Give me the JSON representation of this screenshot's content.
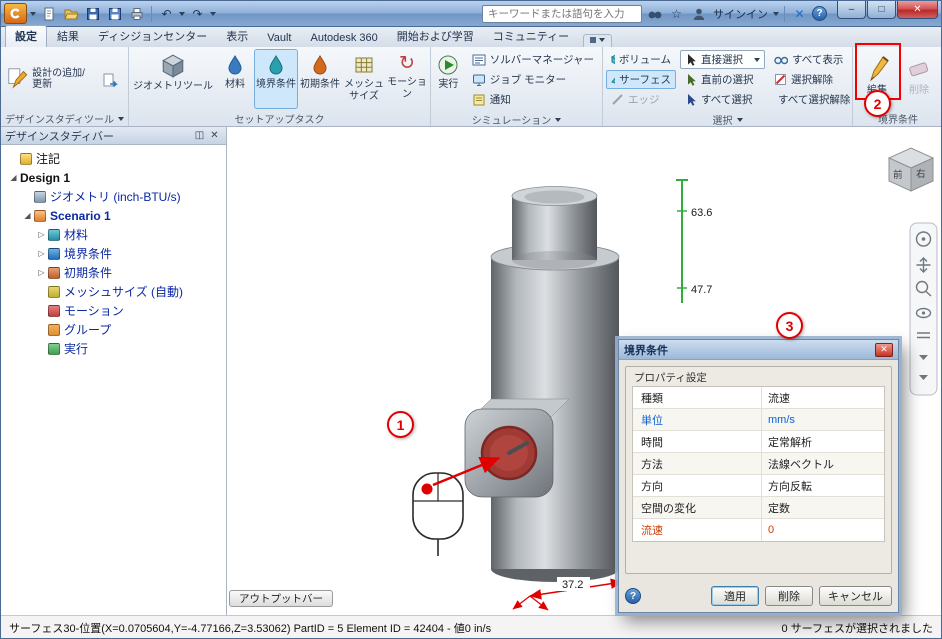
{
  "colors": {
    "highlight_blue": "#cfe7fb",
    "annotation_red": "#e00000",
    "value_blue": "#0a5fd0",
    "value_red": "#c83c00",
    "tree_blue": "#0a28a0"
  },
  "icons": {
    "app_menu_caret": "▾",
    "undo": "↶",
    "redo": "↷",
    "star": "☆",
    "exchange_x": "✕",
    "help": "?",
    "minimize": "–",
    "maximize": "□",
    "close": "✕",
    "pin": "◫",
    "panel_close": "✕",
    "dialog_close": "✕",
    "dialog_help": "?",
    "motion_arrow": "↻",
    "expand_open": "◢",
    "expand_closed": "▷"
  },
  "window": {
    "search_placeholder": "キーワードまたは語句を入力",
    "signin_label": "サインイン"
  },
  "tabs": [
    {
      "label": "設定"
    },
    {
      "label": "結果"
    },
    {
      "label": "ディシジョンセンター"
    },
    {
      "label": "表示"
    },
    {
      "label": "Vault"
    },
    {
      "label": "Autodesk 360"
    },
    {
      "label": "開始および学習"
    },
    {
      "label": "コミュニティー"
    }
  ],
  "ribbon": {
    "design_tools": {
      "group_label": "デザインスタディツール",
      "add_update": "設計の追加/更新"
    },
    "setup": {
      "group_label": "セットアップタスク",
      "geometry_tools": "ジオメトリツール",
      "materials": "材料",
      "boundary": "境界条件",
      "initial": "初期条件",
      "mesh": "メッシュ サイズ",
      "motion": "モーション"
    },
    "simulation": {
      "group_label": "シミュレーション",
      "run": "実行",
      "solver": "ソルバーマネージャー",
      "job": "ジョブ モニター",
      "notify": "通知"
    },
    "selection": {
      "group_label": "選択",
      "volume": "ボリューム",
      "surface": "サーフェス",
      "edge": "エッジ",
      "direct": "直接選択",
      "previous": "直前の選択",
      "select_all": "すべて選択",
      "show_all": "すべて表示",
      "deselect": "選択解除",
      "deselect_all": "すべて選択解除"
    },
    "boundary_group": {
      "group_label": "境界条件",
      "edit": "編集",
      "delete": "削除"
    }
  },
  "sidebar": {
    "title": "デザインスタディバー",
    "items": [
      {
        "label": "注記"
      },
      {
        "label": "Design 1"
      },
      {
        "label": "ジオメトリ (inch-BTU/s)"
      },
      {
        "label": "Scenario 1"
      },
      {
        "label": "材料"
      },
      {
        "label": "境界条件"
      },
      {
        "label": "初期条件"
      },
      {
        "label": "メッシュサイズ (自動)"
      },
      {
        "label": "モーション"
      },
      {
        "label": "グループ"
      },
      {
        "label": "実行"
      }
    ]
  },
  "viewport": {
    "dims": {
      "d1": "63.6",
      "d2": "47.7",
      "d3": "37.2"
    },
    "viewcube": {
      "front": "前",
      "right": "右"
    },
    "output_bar_label": "アウトプットバー"
  },
  "callouts": {
    "c1": "1",
    "c2": "2",
    "c3": "3"
  },
  "dialog": {
    "title": "境界条件",
    "group": "プロパティ設定",
    "rows": [
      {
        "label": "種類",
        "value": "流速"
      },
      {
        "label": "単位",
        "value": "mm/s"
      },
      {
        "label": "時間",
        "value": "定常解析"
      },
      {
        "label": "方法",
        "value": "法線ベクトル"
      },
      {
        "label": "方向",
        "value": "方向反転"
      },
      {
        "label": "空間の変化",
        "value": "定数"
      },
      {
        "label": "流速",
        "value": "0"
      }
    ],
    "apply": "適用",
    "delete": "削除",
    "cancel": "キャンセル"
  },
  "statusbar": {
    "left": "サーフェス30-位置(X=0.0705604,Y=-4.77166,Z=3.53062) PartID = 5 Element ID = 42404 - 値0  in/s",
    "right": "0 サーフェスが選択されました"
  }
}
